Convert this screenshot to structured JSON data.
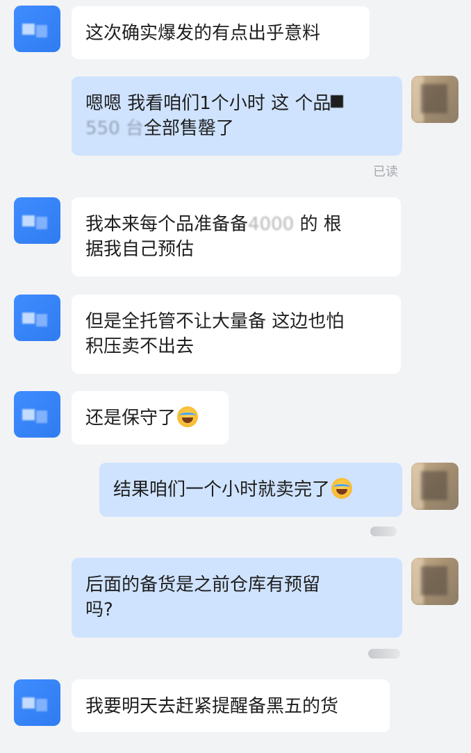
{
  "messages": [
    {
      "id": 1,
      "side": "left",
      "lines": [
        "这次确实爆发的有点出乎意料"
      ]
    },
    {
      "id": 2,
      "side": "right",
      "lines": [
        "嗯嗯 我看咱们1个小时 这 个品",
        "全部售罄了"
      ],
      "status": "已读"
    },
    {
      "id": 3,
      "side": "left",
      "lines": [
        "我本来每个品准备备",
        "的 根",
        "据我自己预估"
      ]
    },
    {
      "id": 4,
      "side": "left",
      "lines": [
        "但是全托管不让大量备  这边也怕",
        "积压卖不出去"
      ]
    },
    {
      "id": 5,
      "side": "left",
      "lines": [
        "还是保守了"
      ],
      "emoji": "laugh-cry-emoji"
    },
    {
      "id": 6,
      "side": "right",
      "lines": [
        "结果咱们一个小时就卖完了"
      ],
      "emoji": "laugh-cry-emoji"
    },
    {
      "id": 7,
      "side": "right",
      "lines": [
        "后面的备货是之前仓库有预留",
        "吗?"
      ]
    },
    {
      "id": 8,
      "side": "left",
      "lines": [
        "我要明天去赶紧提醒备黑五的货"
      ]
    }
  ],
  "colors": {
    "background": "#f2f3f5",
    "left_bubble": "#ffffff",
    "right_bubble": "#cfe3ff",
    "avatar_blue": "#3f8cff",
    "read_text": "#a5a7ab"
  }
}
